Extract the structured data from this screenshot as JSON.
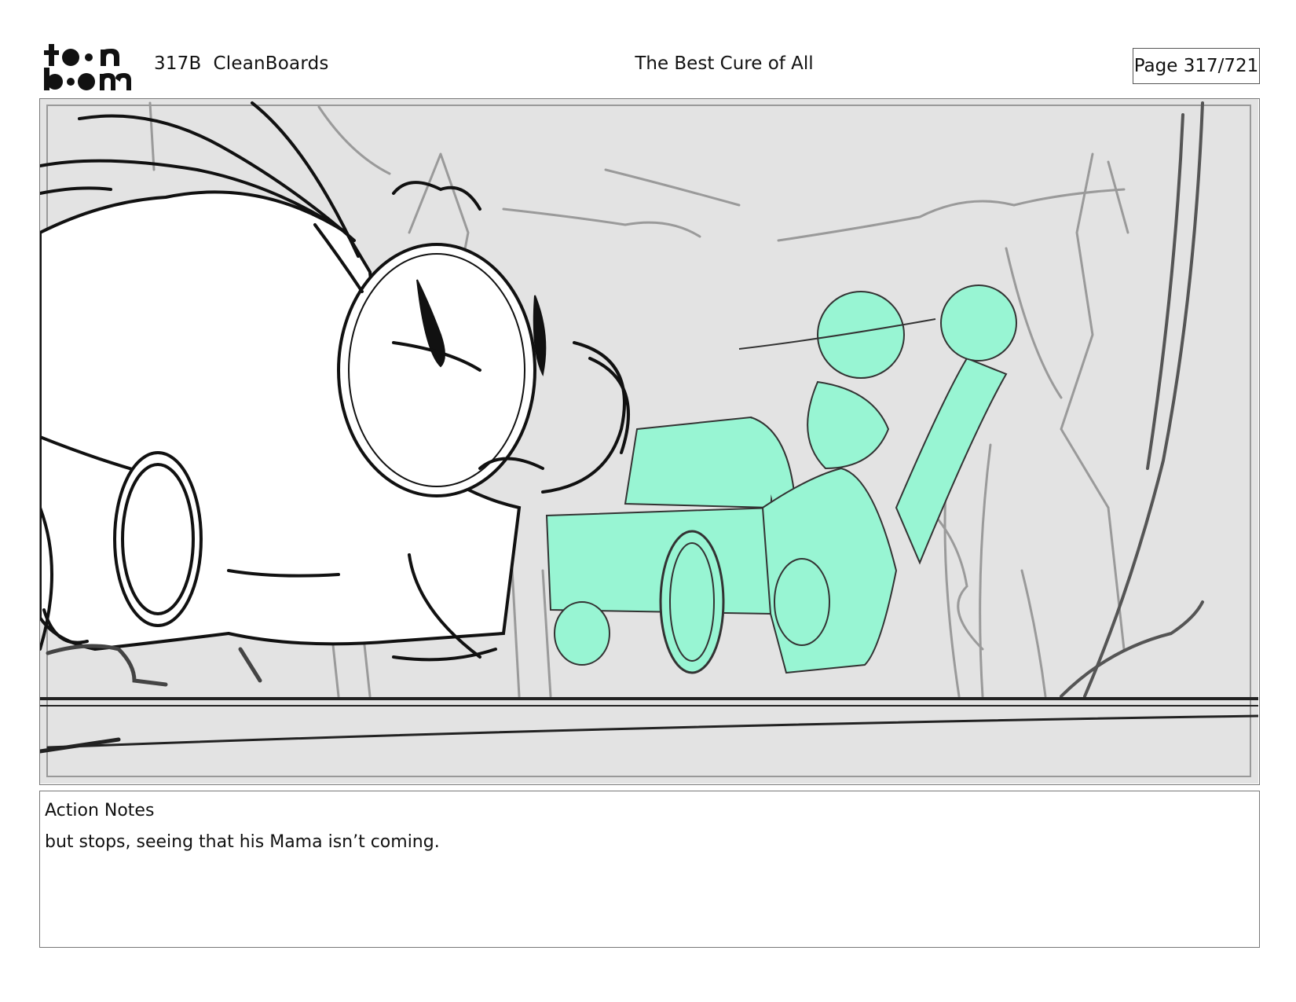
{
  "header": {
    "logo_text": "toon boom",
    "scene_label": "317B  CleanBoards",
    "title": "The Best Cure of All",
    "page_label": "Page 317/721"
  },
  "panel": {
    "frame_color": "#888888",
    "background_color": "#e3e3e3",
    "character_fill": "#ffffff",
    "highlight_color": "#98f5d3",
    "line_color": "#111111",
    "sketch_color": "#9a9a9a"
  },
  "notes": {
    "label": "Action Notes",
    "text": "but stops, seeing that his Mama isn’t coming."
  }
}
